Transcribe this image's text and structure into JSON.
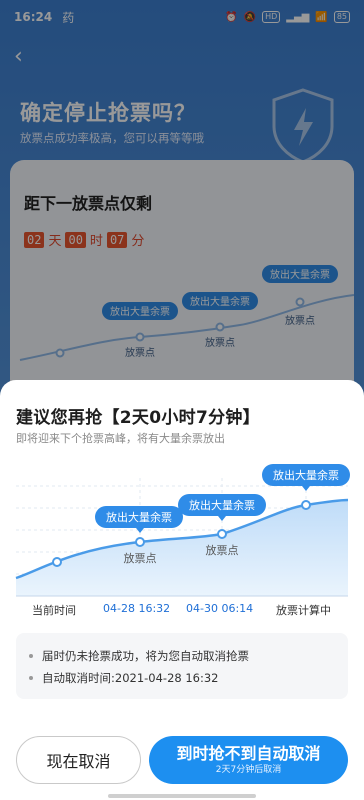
{
  "status_bar": {
    "time": "16:24",
    "app_glyph": "药",
    "right_icons": [
      "alarm-icon",
      "mute-icon",
      "hd-icon",
      "signal-icon",
      "wifi-icon",
      "battery-icon"
    ],
    "hd_label": "HD",
    "battery_label": "85"
  },
  "background": {
    "title": "确定停止抢票吗？",
    "subtitle": "放票点成功率极高，您可以再等等哦",
    "card_title": "距下一放票点仅剩",
    "countdown": {
      "days": "02",
      "days_unit": "天",
      "hours": "00",
      "hours_unit": "时",
      "minutes": "07",
      "minutes_unit": "分"
    },
    "chart_badges": [
      "放出大量余票",
      "放出大量余票",
      "放出大量余票"
    ],
    "chart_labels": [
      "放票点",
      "放票点",
      "放票点"
    ]
  },
  "sheet": {
    "title": "建议您再抢【2天0小时7分钟】",
    "subtitle": "即将迎来下个抢票高峰，将有大量余票放出",
    "badges": [
      "放出大量余票",
      "放出大量余票",
      "放出大量余票"
    ],
    "point_labels": [
      "放票点",
      "放票点"
    ],
    "x_labels": {
      "current": "当前时间",
      "t1": "04-28 16:32",
      "t2": "04-30 06:14",
      "calculating": "放票计算中"
    },
    "info": [
      "届时仍未抢票成功，将为您自动取消抢票",
      "自动取消时间:2021-04-28 16:32"
    ],
    "cancel_label": "现在取消",
    "auto_label": "到时抢不到自动取消",
    "auto_sublabel": "2天7分钟后取消"
  },
  "colors": {
    "accent": "#1d8ff0",
    "badge": "#2f8ce8",
    "countdown": "#e8552f",
    "curve": "#4a9be8"
  }
}
